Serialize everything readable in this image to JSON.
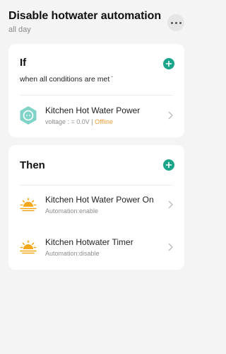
{
  "header": {
    "title": "Disable hotwater automation",
    "subtitle": "all day"
  },
  "if_section": {
    "title": "If",
    "condition_mode": "when all conditions are met",
    "conditions": [
      {
        "name": "Kitchen Hot Water Power",
        "detail_prefix": "voltage : = 0.0V | ",
        "status": "Offline",
        "icon": "smart-plug-icon"
      }
    ]
  },
  "then_section": {
    "title": "Then",
    "actions": [
      {
        "name": "Kitchen Hot Water Power On",
        "detail": "Automation:enable",
        "icon": "sunrise-icon"
      },
      {
        "name": "Kitchen Hotwater Timer",
        "detail": "Automation:disable",
        "icon": "sunrise-icon"
      }
    ]
  },
  "colors": {
    "accent": "#1aa58a",
    "offline": "#e8a13b",
    "scene_icon": "#f2a71b",
    "plug_icon": "#7fd3c8"
  }
}
